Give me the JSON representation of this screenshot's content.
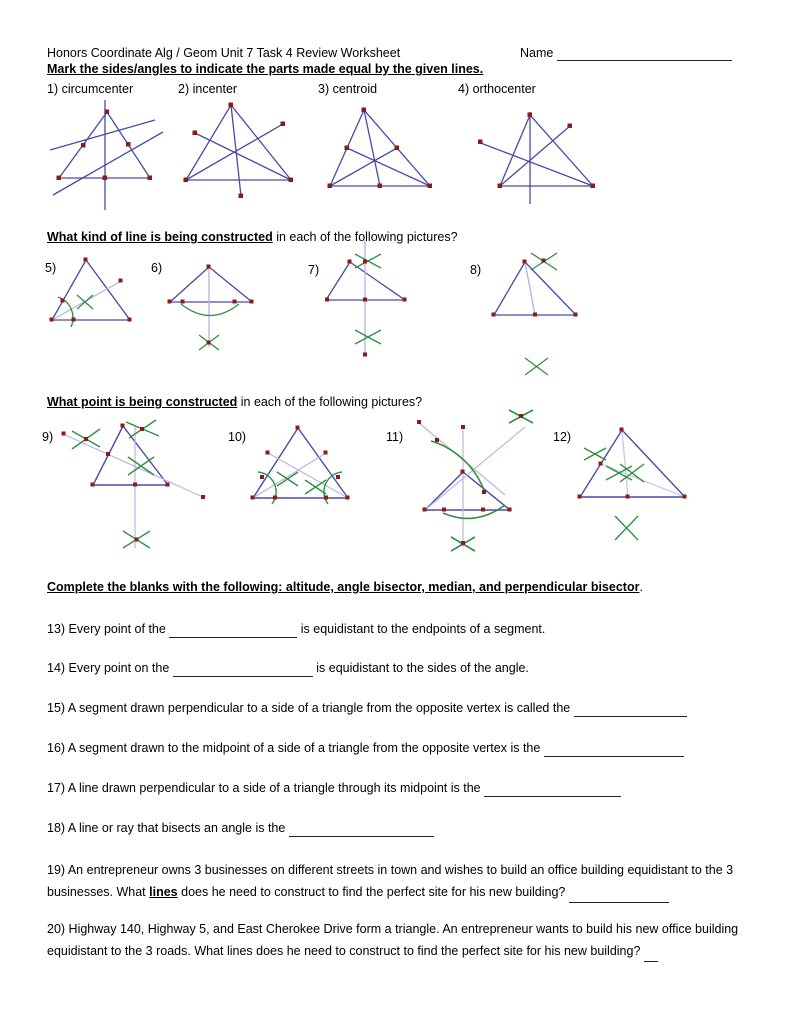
{
  "header": {
    "doc_title": "Honors Coordinate Alg / Geom Unit 7 Task 4 Review Worksheet",
    "name_label": "Name"
  },
  "instructions": {
    "ins1": "Mark the sides/angles to indicate the parts made equal by the given lines.",
    "ins2_bold": "What kind of line is being constructed",
    "ins2_rest": " in each of the following pictures?",
    "ins3_bold": "What point is being constructed",
    "ins3_rest": " in each of the following pictures?",
    "ins4_bold": "Complete the blanks with the following: altitude, angle bisector, median, and perpendicular bisector",
    "ins4_rest": "."
  },
  "figure_labels": {
    "f1": "1)  circumcenter",
    "f2": "2)  incenter",
    "f3": "3)  centroid",
    "f4": "4)  orthocenter",
    "f5": "5)",
    "f6": "6)",
    "f7": "7)",
    "f8": "8)",
    "f9": "9)",
    "f10": "10)",
    "f11": "11)",
    "f12": "12)"
  },
  "questions": {
    "q13a": "13)  Every point of the ",
    "q13b": " is equidistant to the endpoints of a segment.",
    "q14a": "14)  Every point on the ",
    "q14b": " is equidistant to the sides of the angle.",
    "q15a": "15)  A segment drawn perpendicular to a side of a triangle from the opposite vertex is called the ",
    "q15b": "",
    "q16a": "16)  A segment drawn to the midpoint of a side of a triangle from the opposite vertex is the ",
    "q16b": "",
    "q17a": "17)  A line drawn perpendicular to a side of a triangle through its midpoint is the ",
    "q17b": "",
    "q18a": "18) A line or ray that bisects an angle is the ",
    "q18b": "",
    "q19a": "19) An entrepreneur owns 3 businesses on different streets in town and wishes to build an office building equidistant to the 3 businesses.  What ",
    "q19_bold": "lines",
    "q19b": " does he need to construct to find the perfect site for his new building? ",
    "q20a": "20) Highway 140, Highway 5, and East Cherokee Drive form a triangle. An entrepreneur wants to build his new office building equidistant to the 3 roads. What lines does he need to construct to find the perfect site for his new building? ",
    "q20b": ""
  },
  "colors": {
    "line_blue": "#4a4aa6",
    "line_blue_faint": "#aaaad8",
    "vertex_red": "#8b1a1a",
    "arc_green": "#2e9142",
    "text_black": "#1a1a1a",
    "blank_rule": "#222222"
  }
}
